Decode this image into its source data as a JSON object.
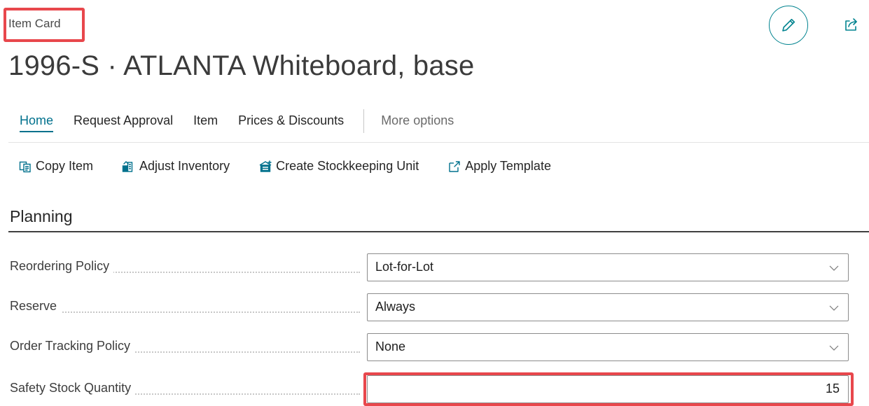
{
  "page": {
    "breadcrumb": "Item Card",
    "title": "1996-S · ATLANTA Whiteboard, base"
  },
  "tabs": [
    {
      "label": "Home"
    },
    {
      "label": "Request Approval"
    },
    {
      "label": "Item"
    },
    {
      "label": "Prices & Discounts"
    },
    {
      "label": "More options"
    }
  ],
  "actions": [
    {
      "label": "Copy Item",
      "icon": "copy-icon"
    },
    {
      "label": "Adjust Inventory",
      "icon": "adjust-inventory-icon"
    },
    {
      "label": "Create Stockkeeping Unit",
      "icon": "stockkeeping-unit-icon"
    },
    {
      "label": "Apply Template",
      "icon": "apply-template-icon"
    }
  ],
  "planning": {
    "title": "Planning",
    "fields": [
      {
        "label": "Reordering Policy",
        "value": "Lot-for-Lot"
      },
      {
        "label": "Reserve",
        "value": "Always"
      },
      {
        "label": "Order Tracking Policy",
        "value": "None"
      },
      {
        "label": "Safety Stock Quantity",
        "value": "15"
      }
    ]
  },
  "colors": {
    "accent": "#00718d",
    "highlight": "#e8474c"
  }
}
